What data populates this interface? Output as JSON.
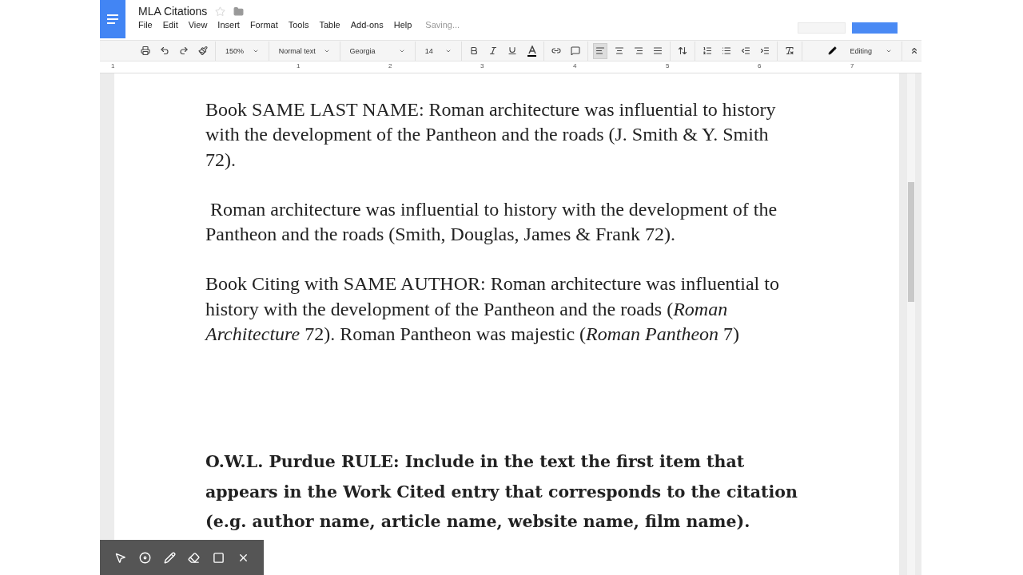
{
  "document": {
    "title": "MLA Citations",
    "status": "Saving..."
  },
  "menu": [
    "File",
    "Edit",
    "View",
    "Insert",
    "Format",
    "Tools",
    "Table",
    "Add-ons",
    "Help"
  ],
  "toolbar": {
    "zoom": "150%",
    "style": "Normal text",
    "font": "Georgia",
    "size": "14",
    "mode": "Editing",
    "alignments": [
      {
        "kind": "left",
        "selected": true
      },
      {
        "kind": "center",
        "selected": false
      },
      {
        "kind": "right",
        "selected": false
      },
      {
        "kind": "justify",
        "selected": false
      }
    ]
  },
  "ruler": [
    "1",
    "1",
    "2",
    "3",
    "4",
    "5",
    "6",
    "7"
  ],
  "paragraphs": [
    {
      "kind": "normal",
      "text": "Book SAME LAST NAME: Roman architecture was influential to history with the development of the Pantheon and the roads (J. Smith & Y. Smith 72)."
    },
    {
      "kind": "normal",
      "text": " Roman architecture was influential to history with the development of the Pantheon and the roads (Smith, Douglas, James & Frank 72)."
    },
    {
      "kind": "normal",
      "text": "Book Citing with SAME AUTHOR: Roman architecture was influential to history with the development of the Pantheon and the roads (*Roman Architecture* 72). Roman Pantheon was majestic (*Roman Pantheon* 7)"
    },
    {
      "kind": "gap"
    },
    {
      "kind": "bold",
      "text": "O.W.L. Purdue RULE: Include in the text the first item that appears in the Work Cited entry that corresponds to the citation (e.g. author name, article name, website name, film name)."
    }
  ]
}
